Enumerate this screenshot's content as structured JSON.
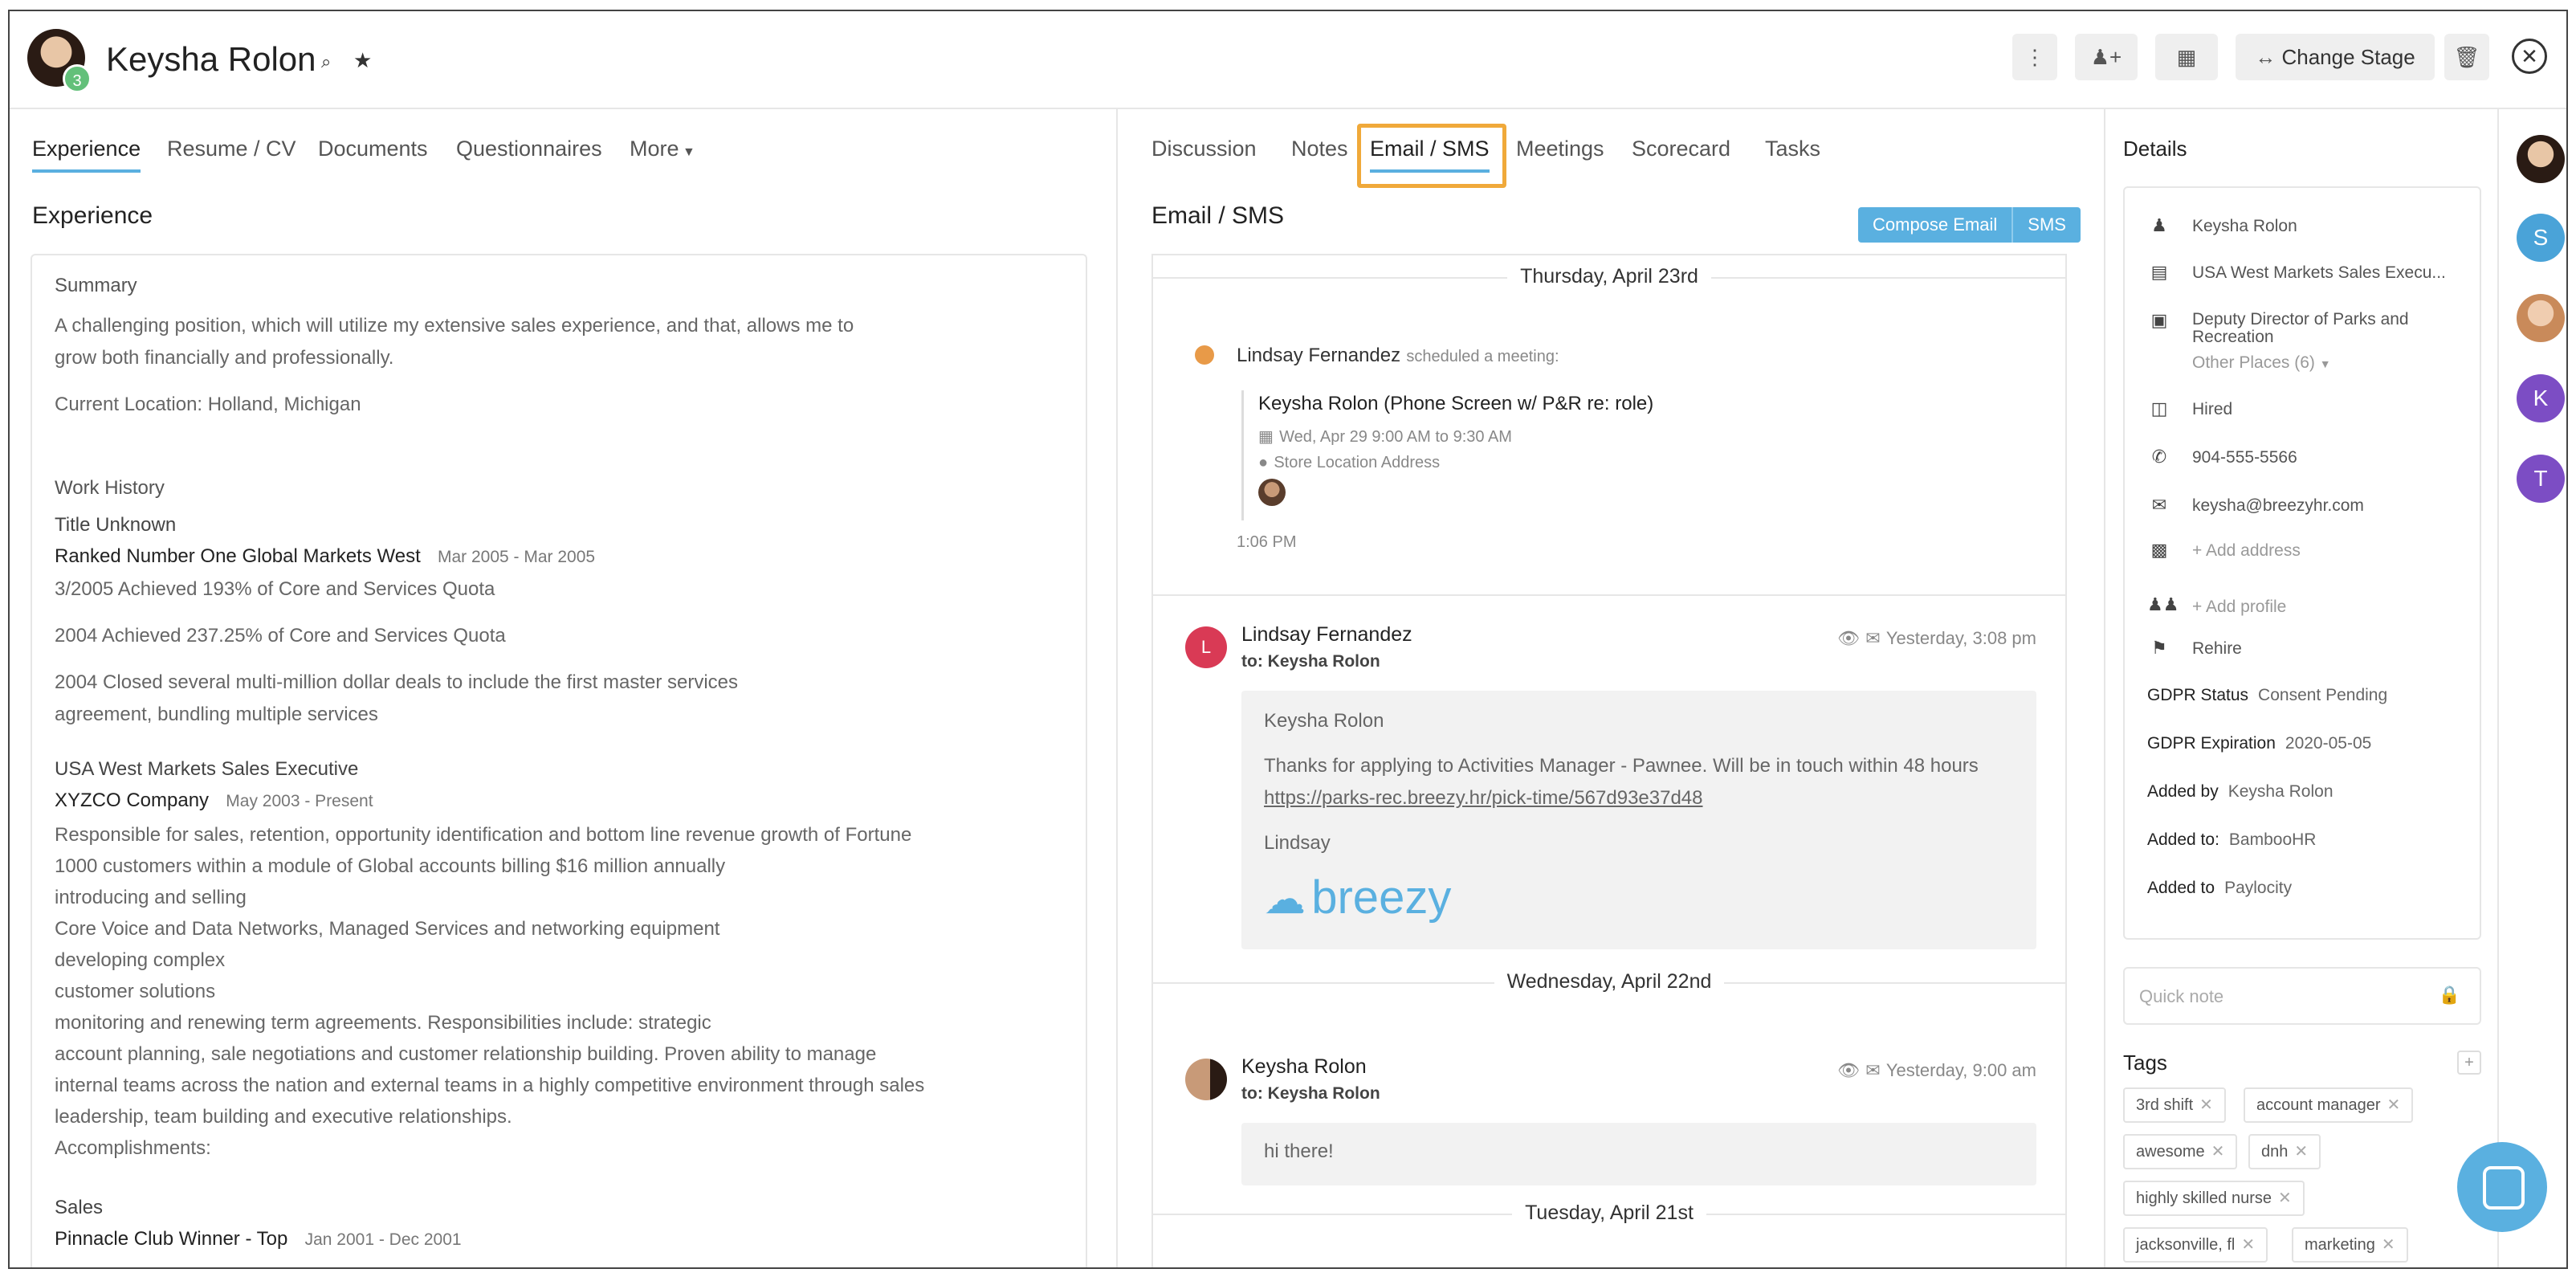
{
  "header": {
    "candidate_name": "Keysha Rolon",
    "avatar_badge": "3",
    "change_stage_label": "Change Stage",
    "icons": [
      "rss-icon",
      "star-icon",
      "more-vertical-icon",
      "add-user-icon",
      "calendar-icon",
      "swap-arrows-icon",
      "trash-icon",
      "close-icon"
    ]
  },
  "left": {
    "tabs": [
      "Experience",
      "Resume / CV",
      "Documents",
      "Questionnaires",
      "More"
    ],
    "section_title": "Experience",
    "summary_label": "Summary",
    "summary_lines": [
      "A challenging position, which will utilize my extensive sales experience, and that, allows me to",
      "grow both financially and professionally."
    ],
    "current_location": "Current Location: Holland, Michigan",
    "work_history_label": "Work History",
    "jobs": [
      {
        "title": "Title Unknown",
        "company": "Ranked Number One Global Markets West",
        "dates": "Mar 2005 - Mar 2005",
        "lines": [
          "3/2005 Achieved 193% of Core and Services Quota",
          "2004 Achieved 237.25% of Core and Services Quota",
          "2004 Closed several multi-million dollar deals to include the first master services",
          "agreement, bundling multiple services"
        ]
      },
      {
        "title": "USA West Markets Sales Executive",
        "company": "XYZCO Company",
        "dates": "May 2003 - Present",
        "lines": [
          "Responsible for sales, retention, opportunity identification and bottom line revenue growth of Fortune",
          "1000 customers within a module of Global accounts billing $16 million annually",
          "introducing and selling",
          "Core Voice and Data Networks, Managed Services and networking equipment",
          "developing complex",
          "customer solutions",
          "monitoring and renewing term agreements. Responsibilities include: strategic",
          "account planning, sale negotiations and customer relationship building. Proven ability to manage",
          "internal teams across the nation and external teams in a highly competitive environment through sales",
          "leadership, team building and executive relationships.",
          "Accomplishments:"
        ]
      },
      {
        "title": "Sales",
        "company": "Pinnacle Club Winner - Top",
        "dates": "Jan 2001 - Dec 2001",
        "lines": []
      }
    ]
  },
  "middle": {
    "tabs": [
      "Discussion",
      "Notes",
      "Email / SMS",
      "Meetings",
      "Scorecard",
      "Tasks"
    ],
    "section_title": "Email / SMS",
    "compose_email": "Compose Email",
    "sms": "SMS",
    "days": [
      "Thursday, April 23rd",
      "Wednesday, April 22nd",
      "Tuesday, April 21st"
    ],
    "meeting": {
      "actor": "Lindsay Fernandez",
      "action": "scheduled a meeting:",
      "title": "Keysha Rolon (Phone Screen w/ P&R re: role)",
      "when": "Wed, Apr 29 9:00 AM to 9:30 AM",
      "where": "Store Location Address",
      "time": "1:06 PM"
    },
    "email1": {
      "avatar_letter": "L",
      "sender": "Lindsay Fernandez",
      "to": "to: Keysha Rolon",
      "timestamp": "Yesterday, 3:08 pm",
      "greeting": "Keysha Rolon",
      "body": "Thanks for applying to Activities Manager - Pawnee. Will be in touch within 48 hours",
      "link": "https://parks-rec.breezy.hr/pick-time/567d93e37d48",
      "signoff": "Lindsay",
      "logo_text": "breezy"
    },
    "email2": {
      "sender": "Keysha Rolon",
      "to": "to: Keysha Rolon",
      "timestamp": "Yesterday, 9:00 am",
      "body": "hi there!"
    }
  },
  "details": {
    "title": "Details",
    "name": "Keysha Rolon",
    "position": "USA West Markets Sales Execu...",
    "place_line1": "Deputy Director of Parks and",
    "place_line2": "Recreation",
    "other_places": "Other Places (6)",
    "status": "Hired",
    "phone": "904-555-5566",
    "email": "keysha@breezyhr.com",
    "add_address": "+ Add address",
    "add_profile": "+ Add profile",
    "rehire": "Rehire",
    "gdpr_status_label": "GDPR Status",
    "gdpr_status_value": "Consent Pending",
    "gdpr_expiration_label": "GDPR Expiration",
    "gdpr_expiration_value": "2020-05-05",
    "added_by_label": "Added by",
    "added_by_value": "Keysha Rolon",
    "added_to_label": "Added to:",
    "added_to_value": "BambooHR",
    "added_to2_label": "Added to",
    "added_to2_value": "Paylocity",
    "quick_note_placeholder": "Quick note",
    "tags_title": "Tags",
    "tags": [
      "3rd shift",
      "account manager",
      "awesome",
      "dnh",
      "highly skilled nurse",
      "jacksonville, fl",
      "marketing"
    ]
  },
  "rail": {
    "letters": [
      "S",
      "K",
      "T"
    ],
    "colors": {
      "S": "#4aa3d8",
      "K": "#7c4dc4",
      "T": "#7c4dc4"
    }
  },
  "colors": {
    "accent": "#5ab0e0",
    "highlight": "#f0a93a",
    "email_avatar": "#d93a55"
  }
}
